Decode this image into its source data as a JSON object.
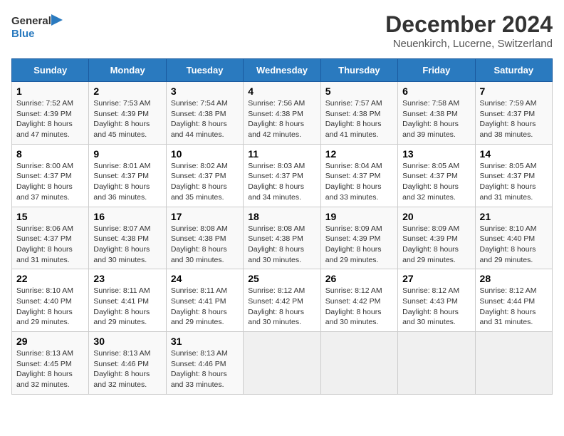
{
  "logo": {
    "general": "General",
    "blue": "Blue"
  },
  "title": "December 2024",
  "subtitle": "Neuenkirch, Lucerne, Switzerland",
  "days_of_week": [
    "Sunday",
    "Monday",
    "Tuesday",
    "Wednesday",
    "Thursday",
    "Friday",
    "Saturday"
  ],
  "weeks": [
    [
      {
        "day": "1",
        "sunrise": "Sunrise: 7:52 AM",
        "sunset": "Sunset: 4:39 PM",
        "daylight": "Daylight: 8 hours and 47 minutes."
      },
      {
        "day": "2",
        "sunrise": "Sunrise: 7:53 AM",
        "sunset": "Sunset: 4:39 PM",
        "daylight": "Daylight: 8 hours and 45 minutes."
      },
      {
        "day": "3",
        "sunrise": "Sunrise: 7:54 AM",
        "sunset": "Sunset: 4:38 PM",
        "daylight": "Daylight: 8 hours and 44 minutes."
      },
      {
        "day": "4",
        "sunrise": "Sunrise: 7:56 AM",
        "sunset": "Sunset: 4:38 PM",
        "daylight": "Daylight: 8 hours and 42 minutes."
      },
      {
        "day": "5",
        "sunrise": "Sunrise: 7:57 AM",
        "sunset": "Sunset: 4:38 PM",
        "daylight": "Daylight: 8 hours and 41 minutes."
      },
      {
        "day": "6",
        "sunrise": "Sunrise: 7:58 AM",
        "sunset": "Sunset: 4:38 PM",
        "daylight": "Daylight: 8 hours and 39 minutes."
      },
      {
        "day": "7",
        "sunrise": "Sunrise: 7:59 AM",
        "sunset": "Sunset: 4:37 PM",
        "daylight": "Daylight: 8 hours and 38 minutes."
      }
    ],
    [
      {
        "day": "8",
        "sunrise": "Sunrise: 8:00 AM",
        "sunset": "Sunset: 4:37 PM",
        "daylight": "Daylight: 8 hours and 37 minutes."
      },
      {
        "day": "9",
        "sunrise": "Sunrise: 8:01 AM",
        "sunset": "Sunset: 4:37 PM",
        "daylight": "Daylight: 8 hours and 36 minutes."
      },
      {
        "day": "10",
        "sunrise": "Sunrise: 8:02 AM",
        "sunset": "Sunset: 4:37 PM",
        "daylight": "Daylight: 8 hours and 35 minutes."
      },
      {
        "day": "11",
        "sunrise": "Sunrise: 8:03 AM",
        "sunset": "Sunset: 4:37 PM",
        "daylight": "Daylight: 8 hours and 34 minutes."
      },
      {
        "day": "12",
        "sunrise": "Sunrise: 8:04 AM",
        "sunset": "Sunset: 4:37 PM",
        "daylight": "Daylight: 8 hours and 33 minutes."
      },
      {
        "day": "13",
        "sunrise": "Sunrise: 8:05 AM",
        "sunset": "Sunset: 4:37 PM",
        "daylight": "Daylight: 8 hours and 32 minutes."
      },
      {
        "day": "14",
        "sunrise": "Sunrise: 8:05 AM",
        "sunset": "Sunset: 4:37 PM",
        "daylight": "Daylight: 8 hours and 31 minutes."
      }
    ],
    [
      {
        "day": "15",
        "sunrise": "Sunrise: 8:06 AM",
        "sunset": "Sunset: 4:37 PM",
        "daylight": "Daylight: 8 hours and 31 minutes."
      },
      {
        "day": "16",
        "sunrise": "Sunrise: 8:07 AM",
        "sunset": "Sunset: 4:38 PM",
        "daylight": "Daylight: 8 hours and 30 minutes."
      },
      {
        "day": "17",
        "sunrise": "Sunrise: 8:08 AM",
        "sunset": "Sunset: 4:38 PM",
        "daylight": "Daylight: 8 hours and 30 minutes."
      },
      {
        "day": "18",
        "sunrise": "Sunrise: 8:08 AM",
        "sunset": "Sunset: 4:38 PM",
        "daylight": "Daylight: 8 hours and 30 minutes."
      },
      {
        "day": "19",
        "sunrise": "Sunrise: 8:09 AM",
        "sunset": "Sunset: 4:39 PM",
        "daylight": "Daylight: 8 hours and 29 minutes."
      },
      {
        "day": "20",
        "sunrise": "Sunrise: 8:09 AM",
        "sunset": "Sunset: 4:39 PM",
        "daylight": "Daylight: 8 hours and 29 minutes."
      },
      {
        "day": "21",
        "sunrise": "Sunrise: 8:10 AM",
        "sunset": "Sunset: 4:40 PM",
        "daylight": "Daylight: 8 hours and 29 minutes."
      }
    ],
    [
      {
        "day": "22",
        "sunrise": "Sunrise: 8:10 AM",
        "sunset": "Sunset: 4:40 PM",
        "daylight": "Daylight: 8 hours and 29 minutes."
      },
      {
        "day": "23",
        "sunrise": "Sunrise: 8:11 AM",
        "sunset": "Sunset: 4:41 PM",
        "daylight": "Daylight: 8 hours and 29 minutes."
      },
      {
        "day": "24",
        "sunrise": "Sunrise: 8:11 AM",
        "sunset": "Sunset: 4:41 PM",
        "daylight": "Daylight: 8 hours and 29 minutes."
      },
      {
        "day": "25",
        "sunrise": "Sunrise: 8:12 AM",
        "sunset": "Sunset: 4:42 PM",
        "daylight": "Daylight: 8 hours and 30 minutes."
      },
      {
        "day": "26",
        "sunrise": "Sunrise: 8:12 AM",
        "sunset": "Sunset: 4:42 PM",
        "daylight": "Daylight: 8 hours and 30 minutes."
      },
      {
        "day": "27",
        "sunrise": "Sunrise: 8:12 AM",
        "sunset": "Sunset: 4:43 PM",
        "daylight": "Daylight: 8 hours and 30 minutes."
      },
      {
        "day": "28",
        "sunrise": "Sunrise: 8:12 AM",
        "sunset": "Sunset: 4:44 PM",
        "daylight": "Daylight: 8 hours and 31 minutes."
      }
    ],
    [
      {
        "day": "29",
        "sunrise": "Sunrise: 8:13 AM",
        "sunset": "Sunset: 4:45 PM",
        "daylight": "Daylight: 8 hours and 32 minutes."
      },
      {
        "day": "30",
        "sunrise": "Sunrise: 8:13 AM",
        "sunset": "Sunset: 4:46 PM",
        "daylight": "Daylight: 8 hours and 32 minutes."
      },
      {
        "day": "31",
        "sunrise": "Sunrise: 8:13 AM",
        "sunset": "Sunset: 4:46 PM",
        "daylight": "Daylight: 8 hours and 33 minutes."
      },
      null,
      null,
      null,
      null
    ]
  ],
  "colors": {
    "header_bg": "#2a7abf",
    "header_text": "#ffffff",
    "accent_blue": "#2a7abf"
  }
}
